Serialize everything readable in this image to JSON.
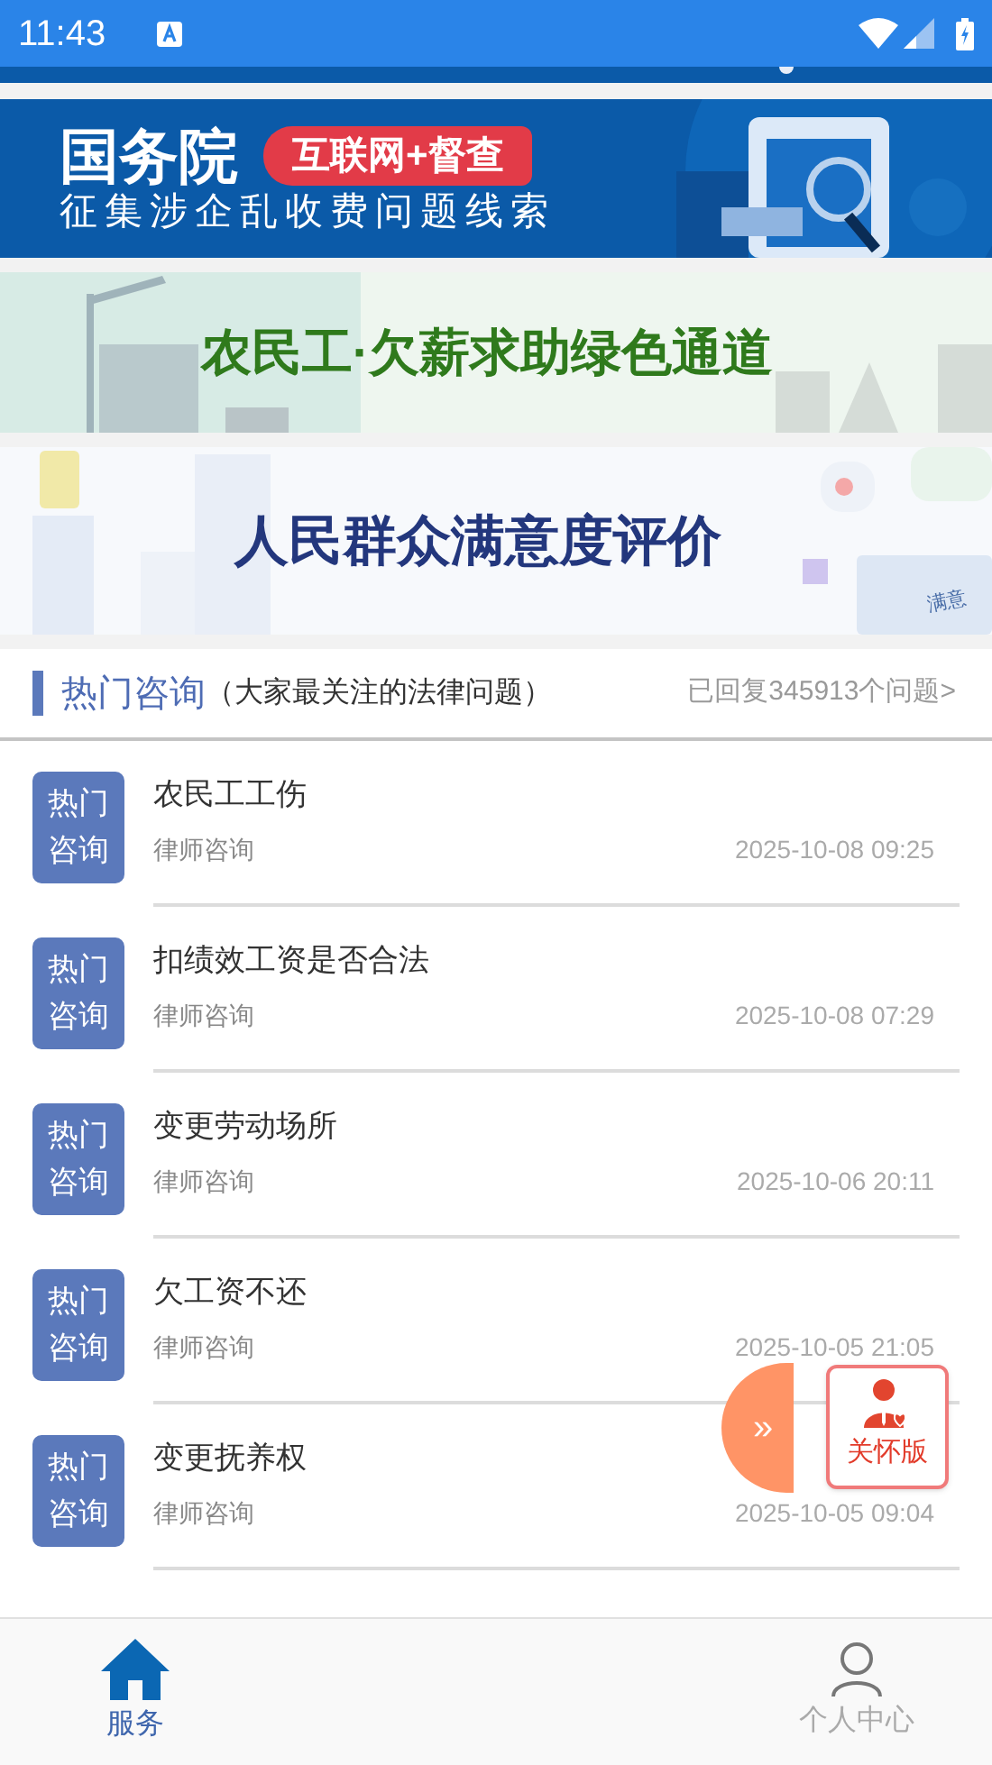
{
  "status_bar": {
    "time": "11:43"
  },
  "banners": [
    {
      "kind": "gov",
      "title": "国务院",
      "tag": "互联网+督查",
      "subtitle": "征集涉企乱收费问题线索"
    },
    {
      "kind": "wage",
      "title": "农民工·欠薪求助绿色通道"
    },
    {
      "kind": "rating",
      "title": "人民群众满意度评价",
      "screen_label": "满意"
    }
  ],
  "section": {
    "title": "热门咨询",
    "subtitle": "（大家最关注的法律问题）",
    "link": "已回复345913个问题>"
  },
  "items": [
    {
      "badge": "热门咨询",
      "title": "农民工工伤",
      "category": "律师咨询",
      "time": "2025-10-08 09:25"
    },
    {
      "badge": "热门咨询",
      "title": "扣绩效工资是否合法",
      "category": "律师咨询",
      "time": "2025-10-08 07:29"
    },
    {
      "badge": "热门咨询",
      "title": "变更劳动场所",
      "category": "律师咨询",
      "time": "2025-10-06 20:11"
    },
    {
      "badge": "热门咨询",
      "title": "欠工资不还",
      "category": "律师咨询",
      "time": "2025-10-05 21:05"
    },
    {
      "badge": "热门咨询",
      "title": "变更抚养权",
      "category": "律师咨询",
      "time": "2025-10-05 09:04"
    }
  ],
  "floating": {
    "handle": "»",
    "label": "关怀版"
  },
  "nav": [
    {
      "kind": "home",
      "label": "服务",
      "selected": true
    },
    {
      "kind": "user",
      "label": "个人中心",
      "selected": false
    }
  ]
}
